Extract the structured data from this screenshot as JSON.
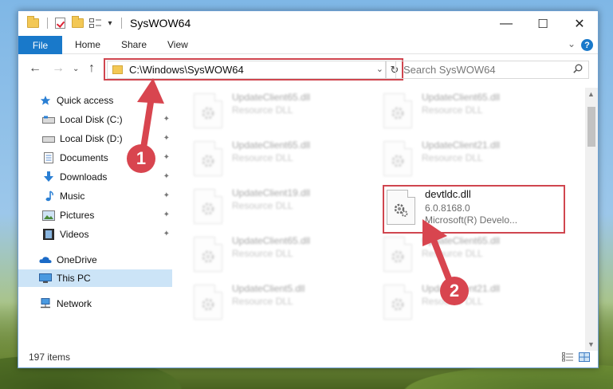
{
  "window": {
    "title": "SysWOW64",
    "minimize_glyph": "—",
    "maximize_glyph": "☐",
    "close_glyph": "✕"
  },
  "ribbon": {
    "tabs": [
      "File",
      "Home",
      "Share",
      "View"
    ],
    "help_glyph": "?",
    "collapse_glyph": "⌄"
  },
  "address": {
    "path": "C:\\Windows\\SysWOW64",
    "dropdown_glyph": "⌄",
    "refresh_glyph": "↻",
    "search_placeholder": "Search SysWOW64"
  },
  "nav": {
    "back_glyph": "←",
    "forward_glyph": "→",
    "recent_glyph": "⌄",
    "up_glyph": "↑"
  },
  "sidebar": {
    "quick_access": "Quick access",
    "items": [
      {
        "label": "Local Disk (C:)",
        "icon": "drive-icon",
        "pinned": true
      },
      {
        "label": "Local Disk (D:)",
        "icon": "drive-icon",
        "pinned": true
      },
      {
        "label": "Documents",
        "icon": "documents-icon",
        "pinned": true
      },
      {
        "label": "Downloads",
        "icon": "downloads-icon",
        "pinned": true
      },
      {
        "label": "Music",
        "icon": "music-icon",
        "pinned": true
      },
      {
        "label": "Pictures",
        "icon": "pictures-icon",
        "pinned": true
      },
      {
        "label": "Videos",
        "icon": "videos-icon",
        "pinned": true
      }
    ],
    "onedrive": "OneDrive",
    "this_pc": "This PC",
    "network": "Network",
    "pin_glyph": "📌"
  },
  "files": [
    {
      "name": "UpdateClient65.dll",
      "line2": "Resource DLL",
      "line3": "",
      "highlighted": false
    },
    {
      "name": "UpdateClient65.dll",
      "line2": "Resource DLL",
      "line3": "",
      "highlighted": false
    },
    {
      "name": "UpdateClient65.dll",
      "line2": "Resource DLL",
      "line3": "",
      "highlighted": false
    },
    {
      "name": "UpdateClient21.dll",
      "line2": "Resource DLL",
      "line3": "",
      "highlighted": false
    },
    {
      "name": "UpdateClient19.dll",
      "line2": "Resource DLL",
      "line3": "",
      "highlighted": false
    },
    {
      "name": "devtldc.dll",
      "line2": "6.0.8168.0",
      "line3": "Microsoft(R) Develo...",
      "highlighted": true
    },
    {
      "name": "UpdateClient65.dll",
      "line2": "Resource DLL",
      "line3": "",
      "highlighted": false
    },
    {
      "name": "UpdateClient65.dll",
      "line2": "Resource DLL",
      "line3": "",
      "highlighted": false
    },
    {
      "name": "UpdateClient5.dll",
      "line2": "Resource DLL",
      "line3": "",
      "highlighted": false
    },
    {
      "name": "UpdateClient21.dll",
      "line2": "Resource DLL",
      "line3": "",
      "highlighted": false
    }
  ],
  "status": {
    "item_count": "197 items"
  },
  "callouts": [
    {
      "label": "1"
    },
    {
      "label": "2"
    }
  ],
  "colors": {
    "accent": "#1979ca",
    "callout": "#d8454f",
    "selection": "#cce4f7"
  }
}
